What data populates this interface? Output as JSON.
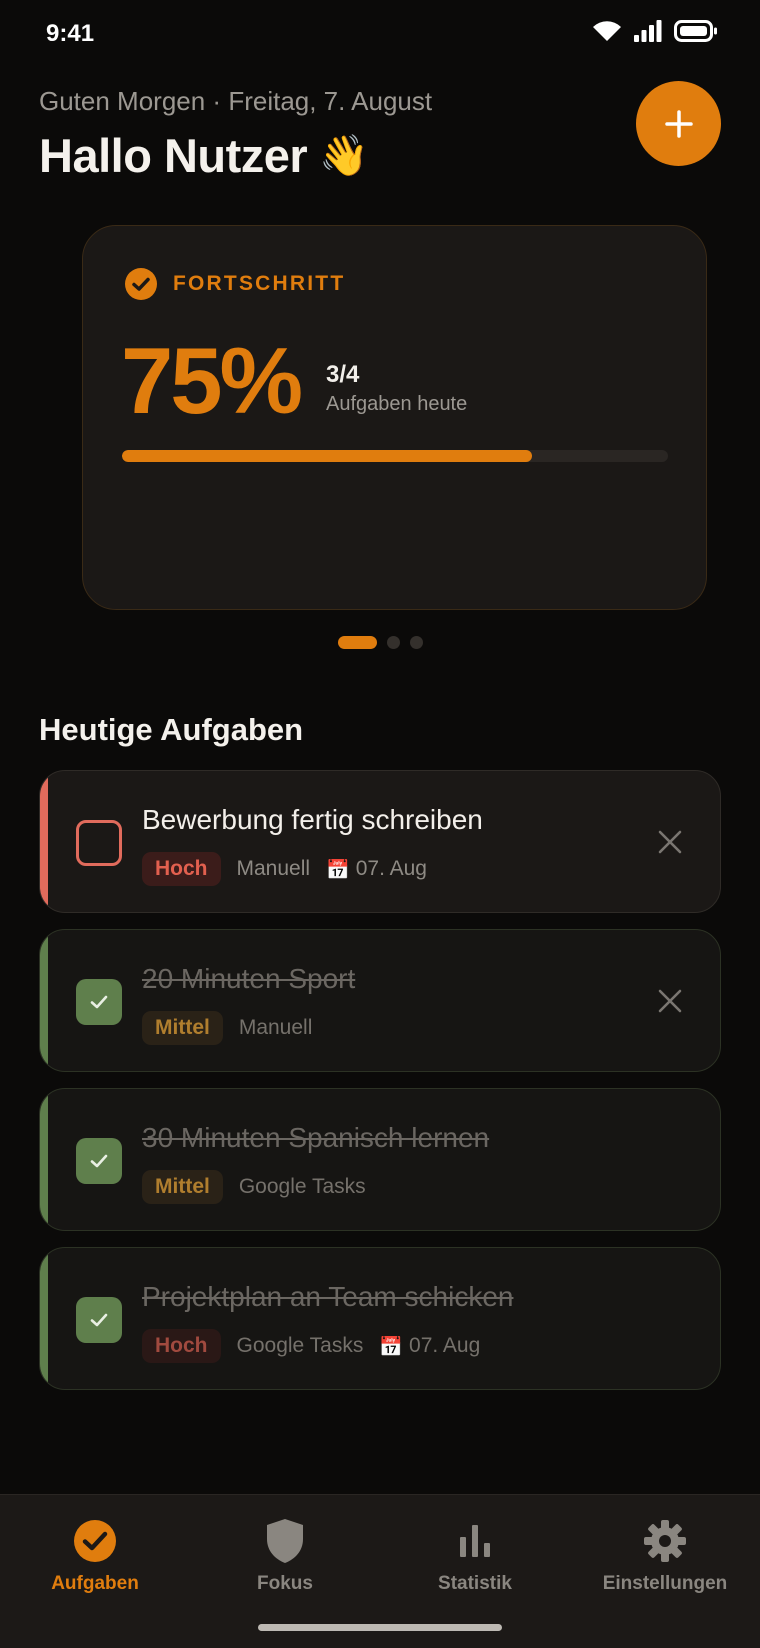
{
  "status_bar": {
    "time": "9:41",
    "icons": [
      "wifi-icon",
      "signal-icon",
      "battery-icon"
    ]
  },
  "header": {
    "greeting": "Guten Morgen · Freitag, 7. August",
    "title": "Hallo Nutzer",
    "title_emoji": "👋",
    "add_button_icon": "plus-icon"
  },
  "progress_card": {
    "label": "FORTSCHRITT",
    "percent_text": "75%",
    "progress_fraction": 0.75,
    "count": "3/4",
    "count_label": "Aufgaben heute",
    "pager_pages": 3,
    "pager_active": 0
  },
  "tasks_section": {
    "title": "Heutige Aufgaben",
    "tasks": [
      {
        "title": "Bewerbung fertig schreiben",
        "priority": "Hoch",
        "source": "Manuell",
        "due": "07. Aug",
        "done": false,
        "accent": "#e16b5c",
        "deletable": true
      },
      {
        "title": "20 Minuten Sport",
        "priority": "Mittel",
        "source": "Manuell",
        "due": "",
        "done": true,
        "accent": "#5f7f4c",
        "deletable": true
      },
      {
        "title": "30 Minuten Spanisch lernen",
        "priority": "Mittel",
        "source": "Google Tasks",
        "due": "",
        "done": true,
        "accent": "#5f7f4c",
        "deletable": false
      },
      {
        "title": "Projektplan an Team schicken",
        "priority": "Hoch",
        "source": "Google Tasks",
        "due": "07. Aug",
        "done": true,
        "accent": "#5f7f4c",
        "deletable": false
      }
    ]
  },
  "bottom_nav": {
    "items": [
      {
        "label": "Aufgaben",
        "icon": "check-circle-icon",
        "active": true
      },
      {
        "label": "Fokus",
        "icon": "shield-icon",
        "active": false
      },
      {
        "label": "Statistik",
        "icon": "bar-chart-icon",
        "active": false
      },
      {
        "label": "Einstellungen",
        "icon": "gear-icon",
        "active": false
      }
    ]
  },
  "colors": {
    "background": "#0b0a09",
    "accent": "#e07d0e",
    "priority_high": "#e2604f",
    "priority_medium": "#d49a3a",
    "done_green": "#5f7f4c"
  }
}
